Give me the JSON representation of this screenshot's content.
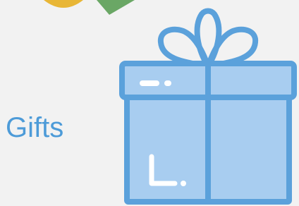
{
  "page": {
    "label": "Gifts"
  },
  "icon": {
    "name": "gift-icon"
  },
  "colors": {
    "background": "#f2f2f2",
    "label_text": "#4d9bd8",
    "gift_fill": "#a8cdf0",
    "gift_stroke": "#5ba1db",
    "gift_highlight": "#ffffff",
    "yellow_decor": "#e8b636",
    "green_decor": "#6aa765"
  }
}
